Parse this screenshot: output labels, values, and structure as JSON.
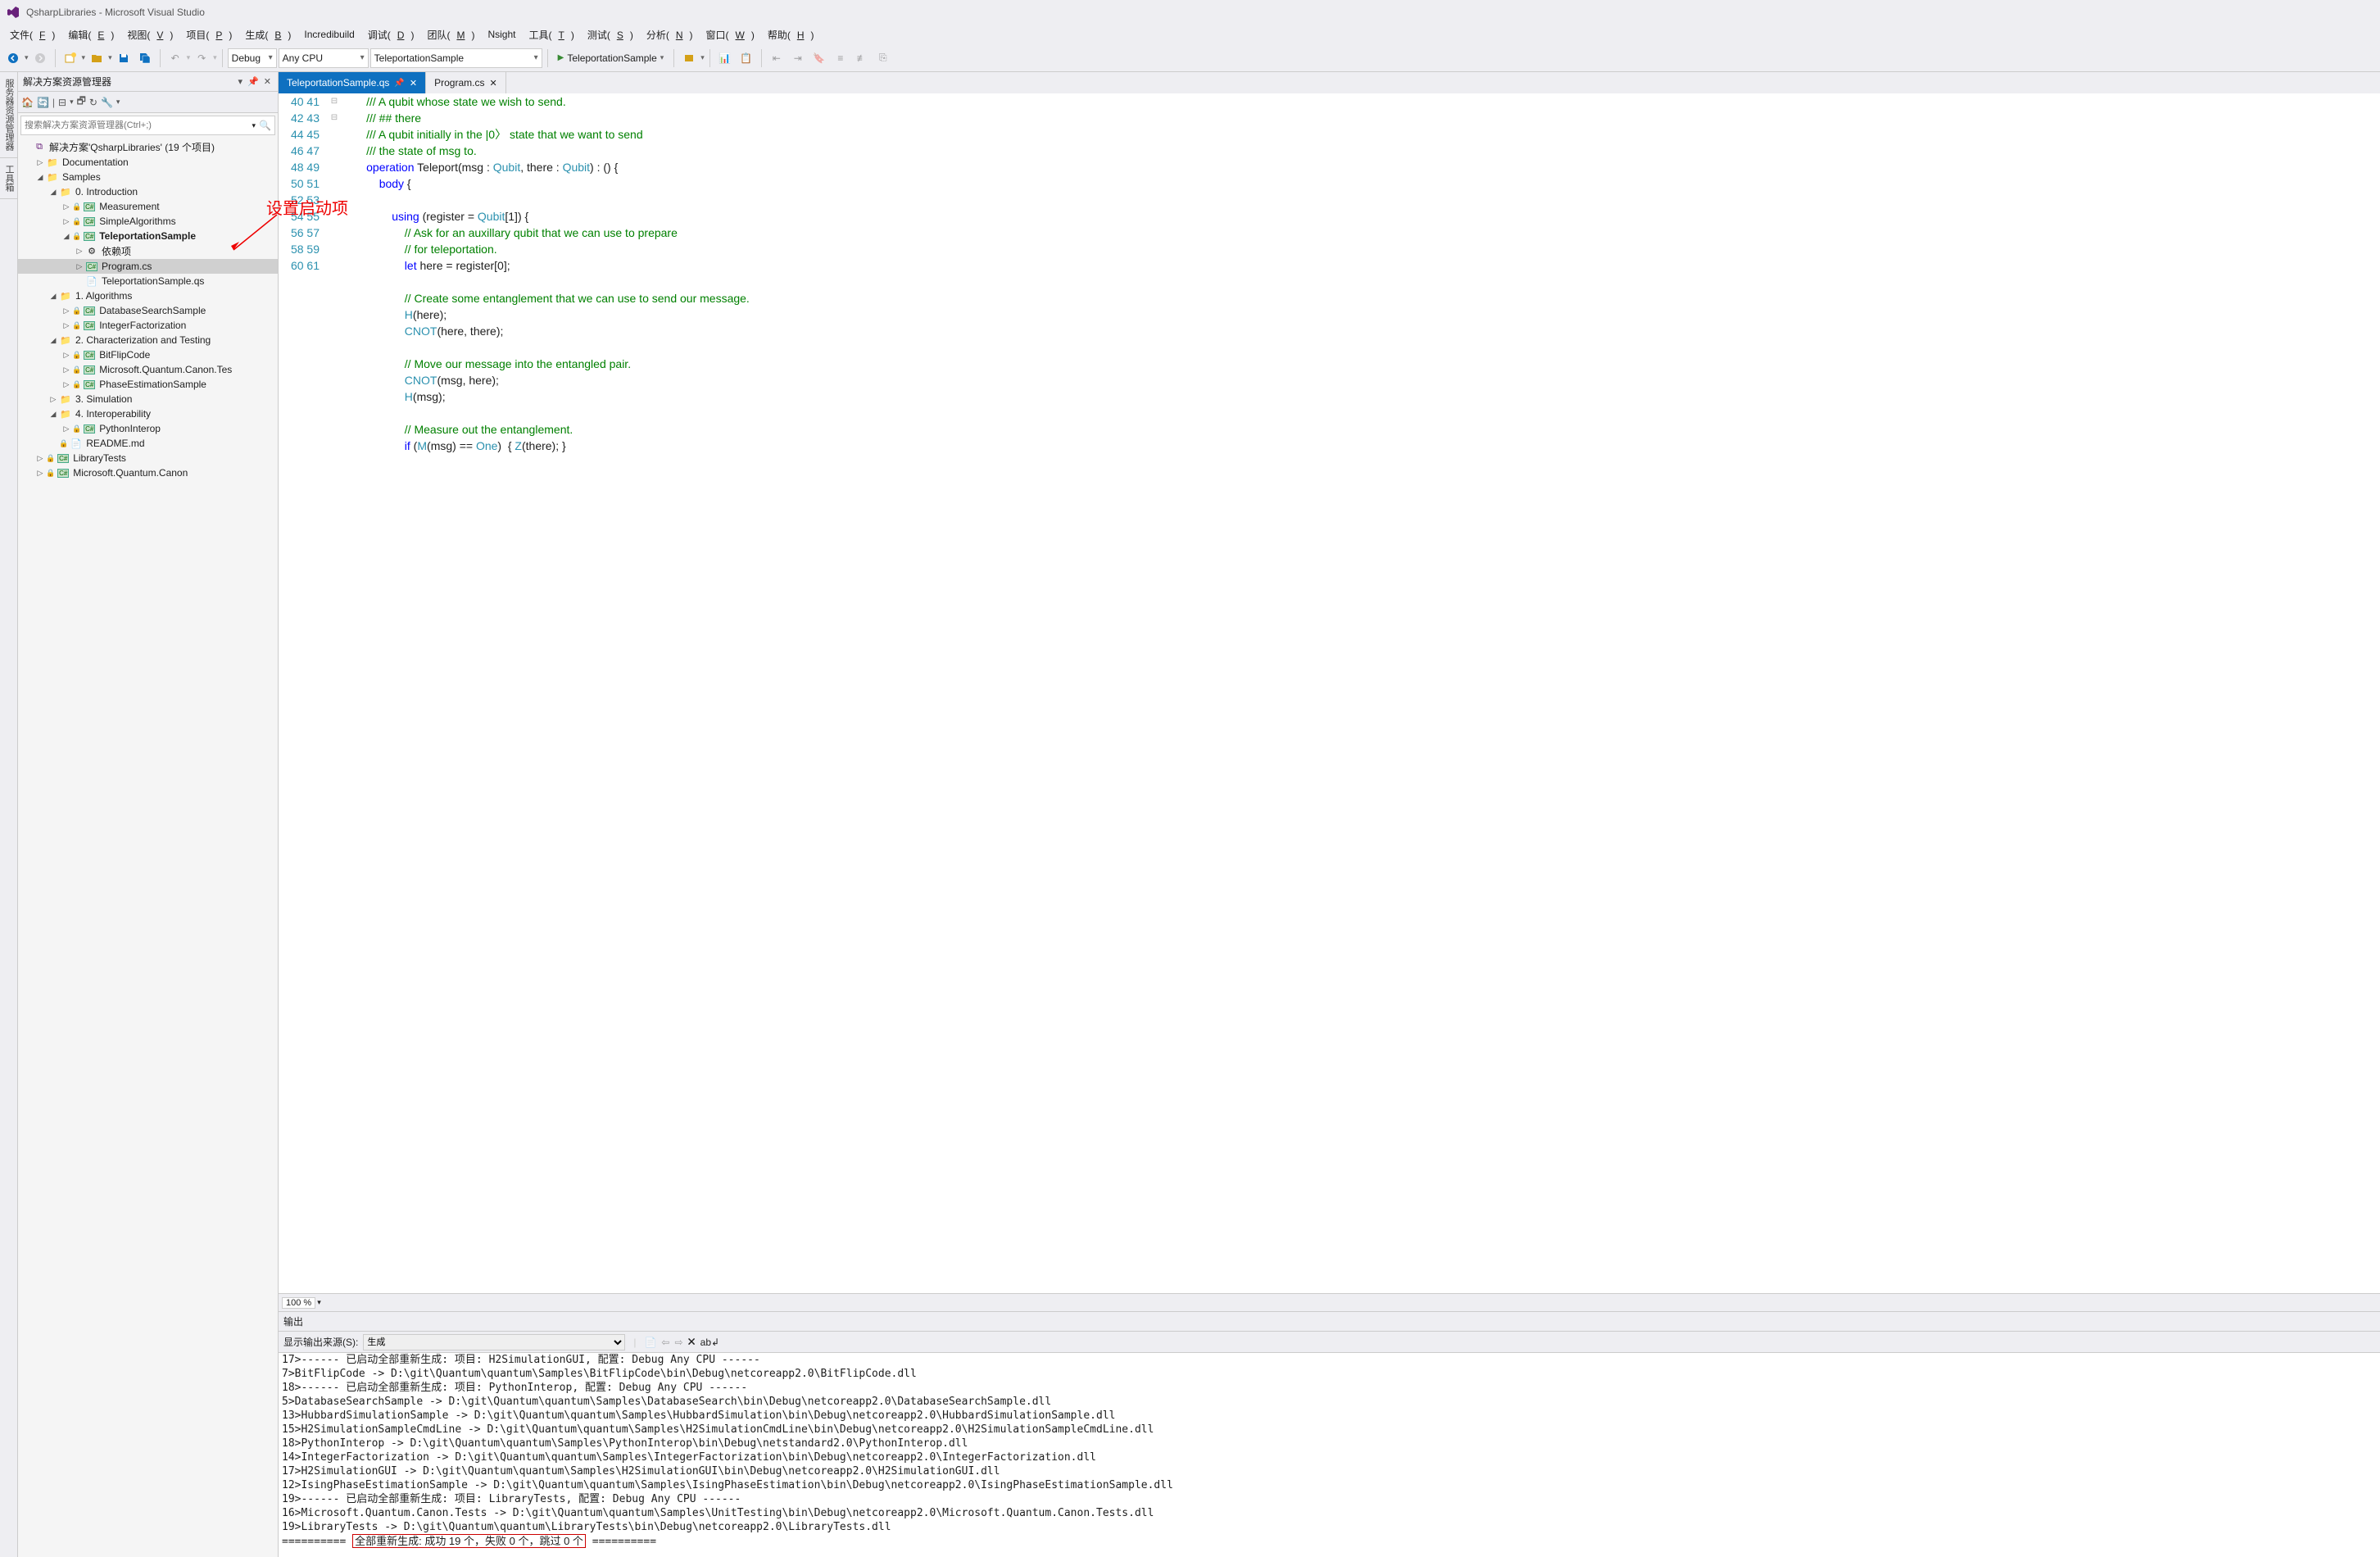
{
  "window": {
    "title": "QsharpLibraries - Microsoft Visual Studio"
  },
  "menu": [
    "文件(F)",
    "编辑(E)",
    "视图(V)",
    "项目(P)",
    "生成(B)",
    "Incredibuild",
    "调试(D)",
    "团队(M)",
    "Nsight",
    "工具(T)",
    "测试(S)",
    "分析(N)",
    "窗口(W)",
    "帮助(H)"
  ],
  "toolbar": {
    "config": "Debug",
    "platform": "Any CPU",
    "startup": "TeleportationSample",
    "run_label": "TeleportationSample"
  },
  "side_tabs": [
    "服务器资源管理器",
    "工具箱"
  ],
  "solution_panel": {
    "title": "解决方案资源管理器",
    "search_placeholder": "搜索解决方案资源管理器(Ctrl+;)",
    "root": "解决方案'QsharpLibraries' (19 个项目)"
  },
  "tree": [
    {
      "depth": 0,
      "arrow": "",
      "type": "sln",
      "label": "解决方案'QsharpLibraries' (19 个项目)"
    },
    {
      "depth": 1,
      "arrow": "▷",
      "type": "folder",
      "label": "Documentation"
    },
    {
      "depth": 1,
      "arrow": "◢",
      "type": "folder",
      "label": "Samples"
    },
    {
      "depth": 2,
      "arrow": "◢",
      "type": "folder",
      "label": "0. Introduction"
    },
    {
      "depth": 3,
      "arrow": "▷",
      "type": "cs",
      "lock": true,
      "label": "Measurement"
    },
    {
      "depth": 3,
      "arrow": "▷",
      "type": "cs",
      "lock": true,
      "label": "SimpleAlgorithms"
    },
    {
      "depth": 3,
      "arrow": "◢",
      "type": "cs",
      "lock": true,
      "label": "TeleportationSample",
      "bold": true
    },
    {
      "depth": 4,
      "arrow": "▷",
      "type": "dep",
      "label": "依赖项"
    },
    {
      "depth": 4,
      "arrow": "▷",
      "type": "csfile",
      "label": "Program.cs",
      "selected": true
    },
    {
      "depth": 4,
      "arrow": "",
      "type": "file",
      "label": "TeleportationSample.qs"
    },
    {
      "depth": 2,
      "arrow": "◢",
      "type": "folder",
      "label": "1. Algorithms"
    },
    {
      "depth": 3,
      "arrow": "▷",
      "type": "cs",
      "lock": true,
      "label": "DatabaseSearchSample"
    },
    {
      "depth": 3,
      "arrow": "▷",
      "type": "cs",
      "lock": true,
      "label": "IntegerFactorization"
    },
    {
      "depth": 2,
      "arrow": "◢",
      "type": "folder",
      "label": "2. Characterization and Testing"
    },
    {
      "depth": 3,
      "arrow": "▷",
      "type": "cs",
      "lock": true,
      "label": "BitFlipCode"
    },
    {
      "depth": 3,
      "arrow": "▷",
      "type": "cs",
      "lock": true,
      "label": "Microsoft.Quantum.Canon.Tes"
    },
    {
      "depth": 3,
      "arrow": "▷",
      "type": "cs",
      "lock": true,
      "label": "PhaseEstimationSample"
    },
    {
      "depth": 2,
      "arrow": "▷",
      "type": "folder",
      "label": "3. Simulation"
    },
    {
      "depth": 2,
      "arrow": "◢",
      "type": "folder",
      "label": "4. Interoperability"
    },
    {
      "depth": 3,
      "arrow": "▷",
      "type": "cs",
      "lock": true,
      "label": "PythonInterop"
    },
    {
      "depth": 2,
      "arrow": "",
      "type": "md",
      "lock": true,
      "label": "README.md"
    },
    {
      "depth": 1,
      "arrow": "▷",
      "type": "cs",
      "lock": true,
      "label": "LibraryTests"
    },
    {
      "depth": 1,
      "arrow": "▷",
      "type": "cs",
      "lock": true,
      "label": "Microsoft.Quantum.Canon"
    }
  ],
  "tabs": [
    {
      "label": "TeleportationSample.qs",
      "active": true,
      "pinned": true
    },
    {
      "label": "Program.cs",
      "active": false
    }
  ],
  "annotation": "设置启动项",
  "zoom": "100 %",
  "code_start": 40,
  "code": [
    {
      "n": 40,
      "f": "",
      "h": "        <span class='c-comment'>/// A qubit whose state we wish to send.</span>"
    },
    {
      "n": 41,
      "f": "",
      "h": "        <span class='c-comment'>/// ## there</span>"
    },
    {
      "n": 42,
      "f": "",
      "h": "        <span class='c-comment'>/// A qubit initially in the |0〉 state that we want to send</span>"
    },
    {
      "n": 43,
      "f": "",
      "h": "        <span class='c-comment'>/// the state of msg to.</span>"
    },
    {
      "n": 44,
      "f": "⊟",
      "h": "        <span class='c-keyword'>operation</span> Teleport(msg : <span class='c-type'>Qubit</span>, there : <span class='c-type'>Qubit</span>) : () {"
    },
    {
      "n": 45,
      "f": "⊟",
      "h": "            <span class='c-keyword'>body</span> {"
    },
    {
      "n": 46,
      "f": "",
      "h": ""
    },
    {
      "n": 47,
      "f": "",
      "h": "                <span class='c-keyword'>using</span> (register = <span class='c-type'>Qubit</span>[1]) {"
    },
    {
      "n": 48,
      "f": "",
      "h": "                    <span class='c-comment'>// Ask for an auxillary qubit that we can use to prepare</span>"
    },
    {
      "n": 49,
      "f": "",
      "h": "                    <span class='c-comment'>// for teleportation.</span>"
    },
    {
      "n": 50,
      "f": "",
      "h": "                    <span class='c-keyword'>let</span> here = register[0];"
    },
    {
      "n": 51,
      "f": "",
      "h": ""
    },
    {
      "n": 52,
      "f": "",
      "h": "                    <span class='c-comment'>// Create some entanglement that we can use to send our message.</span>"
    },
    {
      "n": 53,
      "f": "",
      "h": "                    <span class='c-type'>H</span>(here);"
    },
    {
      "n": 54,
      "f": "",
      "h": "                    <span class='c-type'>CNOT</span>(here, there);"
    },
    {
      "n": 55,
      "f": "",
      "h": ""
    },
    {
      "n": 56,
      "f": "",
      "h": "                    <span class='c-comment'>// Move our message into the entangled pair.</span>"
    },
    {
      "n": 57,
      "f": "",
      "h": "                    <span class='c-type'>CNOT</span>(msg, here);"
    },
    {
      "n": 58,
      "f": "",
      "h": "                    <span class='c-type'>H</span>(msg);"
    },
    {
      "n": 59,
      "f": "",
      "h": ""
    },
    {
      "n": 60,
      "f": "",
      "h": "                    <span class='c-comment'>// Measure out the entanglement.</span>"
    },
    {
      "n": 61,
      "f": "",
      "h": "                    <span class='c-keyword'>if</span> (<span class='c-type'>M</span>(msg) == <span class='c-type'>One</span>)  { <span class='c-type'>Z</span>(there); }"
    }
  ],
  "output": {
    "title": "输出",
    "source_label": "显示输出来源(S):",
    "source_value": "生成",
    "lines": [
      "17>------ 已启动全部重新生成: 项目: H2SimulationGUI, 配置: Debug Any CPU ------",
      "7>BitFlipCode -> D:\\git\\Quantum\\quantum\\Samples\\BitFlipCode\\bin\\Debug\\netcoreapp2.0\\BitFlipCode.dll",
      "18>------ 已启动全部重新生成: 项目: PythonInterop, 配置: Debug Any CPU ------",
      "5>DatabaseSearchSample -> D:\\git\\Quantum\\quantum\\Samples\\DatabaseSearch\\bin\\Debug\\netcoreapp2.0\\DatabaseSearchSample.dll",
      "13>HubbardSimulationSample -> D:\\git\\Quantum\\quantum\\Samples\\HubbardSimulation\\bin\\Debug\\netcoreapp2.0\\HubbardSimulationSample.dll",
      "15>H2SimulationSampleCmdLine -> D:\\git\\Quantum\\quantum\\Samples\\H2SimulationCmdLine\\bin\\Debug\\netcoreapp2.0\\H2SimulationSampleCmdLine.dll",
      "18>PythonInterop -> D:\\git\\Quantum\\quantum\\Samples\\PythonInterop\\bin\\Debug\\netstandard2.0\\PythonInterop.dll",
      "14>IntegerFactorization -> D:\\git\\Quantum\\quantum\\Samples\\IntegerFactorization\\bin\\Debug\\netcoreapp2.0\\IntegerFactorization.dll",
      "17>H2SimulationGUI -> D:\\git\\Quantum\\quantum\\Samples\\H2SimulationGUI\\bin\\Debug\\netcoreapp2.0\\H2SimulationGUI.dll",
      "12>IsingPhaseEstimationSample -> D:\\git\\Quantum\\quantum\\Samples\\IsingPhaseEstimation\\bin\\Debug\\netcoreapp2.0\\IsingPhaseEstimationSample.dll",
      "19>------ 已启动全部重新生成: 项目: LibraryTests, 配置: Debug Any CPU ------",
      "16>Microsoft.Quantum.Canon.Tests -> D:\\git\\Quantum\\quantum\\Samples\\UnitTesting\\bin\\Debug\\netcoreapp2.0\\Microsoft.Quantum.Canon.Tests.dll",
      "19>LibraryTests -> D:\\git\\Quantum\\quantum\\LibraryTests\\bin\\Debug\\netcoreapp2.0\\LibraryTests.dll"
    ],
    "summary_prefix": "========== ",
    "summary_hl": "全部重新生成: 成功 19 个，失败 0 个，跳过 0 个",
    "summary_suffix": " =========="
  }
}
